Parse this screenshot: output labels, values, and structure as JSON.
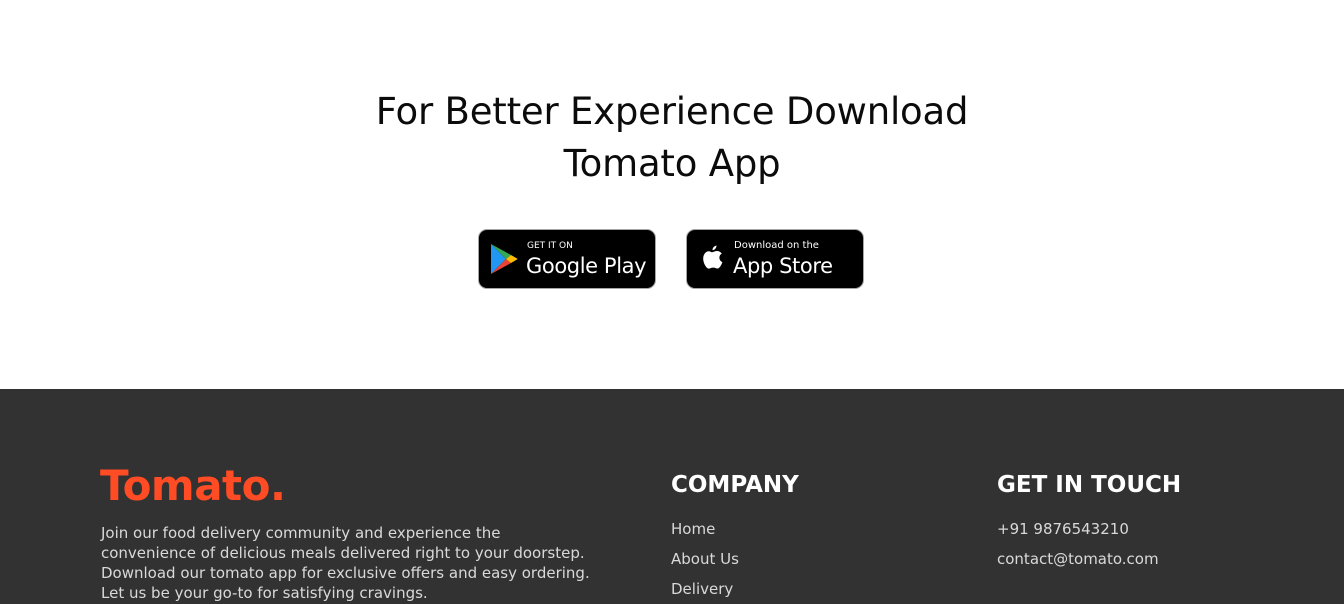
{
  "app_download": {
    "title_line1": "For Better Experience Download",
    "title_line2": "Tomato App",
    "google_play": {
      "small": "GET IT ON",
      "big": "Google Play",
      "icon": "google-play-icon"
    },
    "app_store": {
      "small": "Download on the",
      "big": "App Store",
      "icon": "apple-icon"
    }
  },
  "footer": {
    "logo": "Tomato.",
    "description": "Join our food delivery community and experience the convenience of delicious meals delivered right to your doorstep. Download our tomato app for exclusive offers and easy ordering. Let us be your go-to for satisfying cravings.",
    "company": {
      "heading": "COMPANY",
      "links": [
        "Home",
        "About Us",
        "Delivery"
      ]
    },
    "contact": {
      "heading": "GET IN TOUCH",
      "phone": "+91 9876543210",
      "email": "contact@tomato.com"
    }
  },
  "colors": {
    "brand": "#ff4c24",
    "footer_bg": "#323232",
    "footer_text": "#d9d9d9"
  }
}
